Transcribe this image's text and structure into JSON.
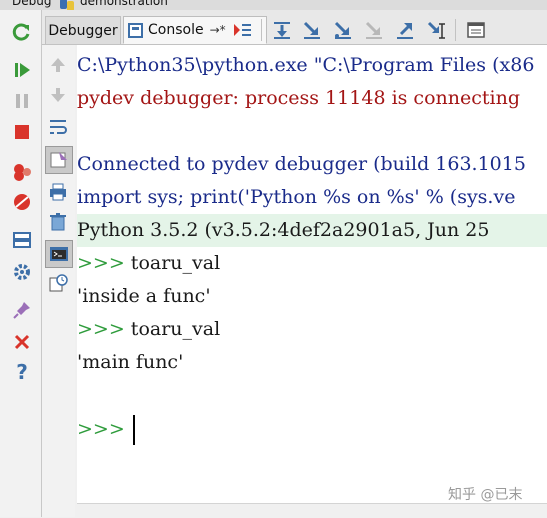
{
  "window": {
    "title_left": "Debug",
    "title_right": "demonstration"
  },
  "tabs": [
    {
      "label": "Debugger"
    },
    {
      "label": "Console",
      "pin": "→*"
    }
  ],
  "console": {
    "lines": [
      {
        "text": "C:\\Python35\\python.exe \"C:\\Program Files (x86",
        "style": "blue"
      },
      {
        "text": "pydev debugger: process 11148 is connecting",
        "style": "err"
      },
      {
        "text": "",
        "style": "out"
      },
      {
        "text": "Connected to pydev debugger (build 163.1015",
        "style": "blue"
      },
      {
        "text": "import sys; print('Python %s on %s' % (sys.ve",
        "style": "blue"
      },
      {
        "text": "Python 3.5.2 (v3.5.2:4def2a2901a5, Jun 25",
        "style": "pyver"
      }
    ],
    "history": [
      {
        "prompt": ">>>",
        "input": " toaru_val"
      },
      {
        "output": "'inside a func'"
      },
      {
        "prompt": ">>>",
        "input": " toaru_val"
      },
      {
        "output": "'main func'"
      }
    ],
    "active_prompt": ">>>"
  },
  "watermark": "知乎 @已末",
  "colors": {
    "prompt": "#2f9c3c",
    "error_text": "#a31515",
    "banner_bg": "#e4f4e8"
  },
  "icons": {
    "left_toolbar": [
      "rerun-icon",
      "resume-icon",
      "pause-icon",
      "stop-icon",
      "view-breakpoints-icon",
      "mute-breakpoints-icon",
      "layout-icon",
      "settings-icon",
      "pin-icon",
      "close-icon",
      "help-icon"
    ],
    "mid_toolbar": [
      "scroll-up-icon",
      "scroll-down-icon",
      "soft-wrap-icon",
      "show-console-icon",
      "print-icon",
      "clear-icon",
      "console-prompt-icon",
      "history-icon"
    ],
    "tab_toolbar": [
      "show-execution-point-icon",
      "step-over-icon",
      "step-into-icon",
      "step-into-my-code-icon",
      "force-step-into-icon",
      "step-out-icon",
      "run-to-cursor-icon",
      "evaluate-expression-icon"
    ]
  }
}
